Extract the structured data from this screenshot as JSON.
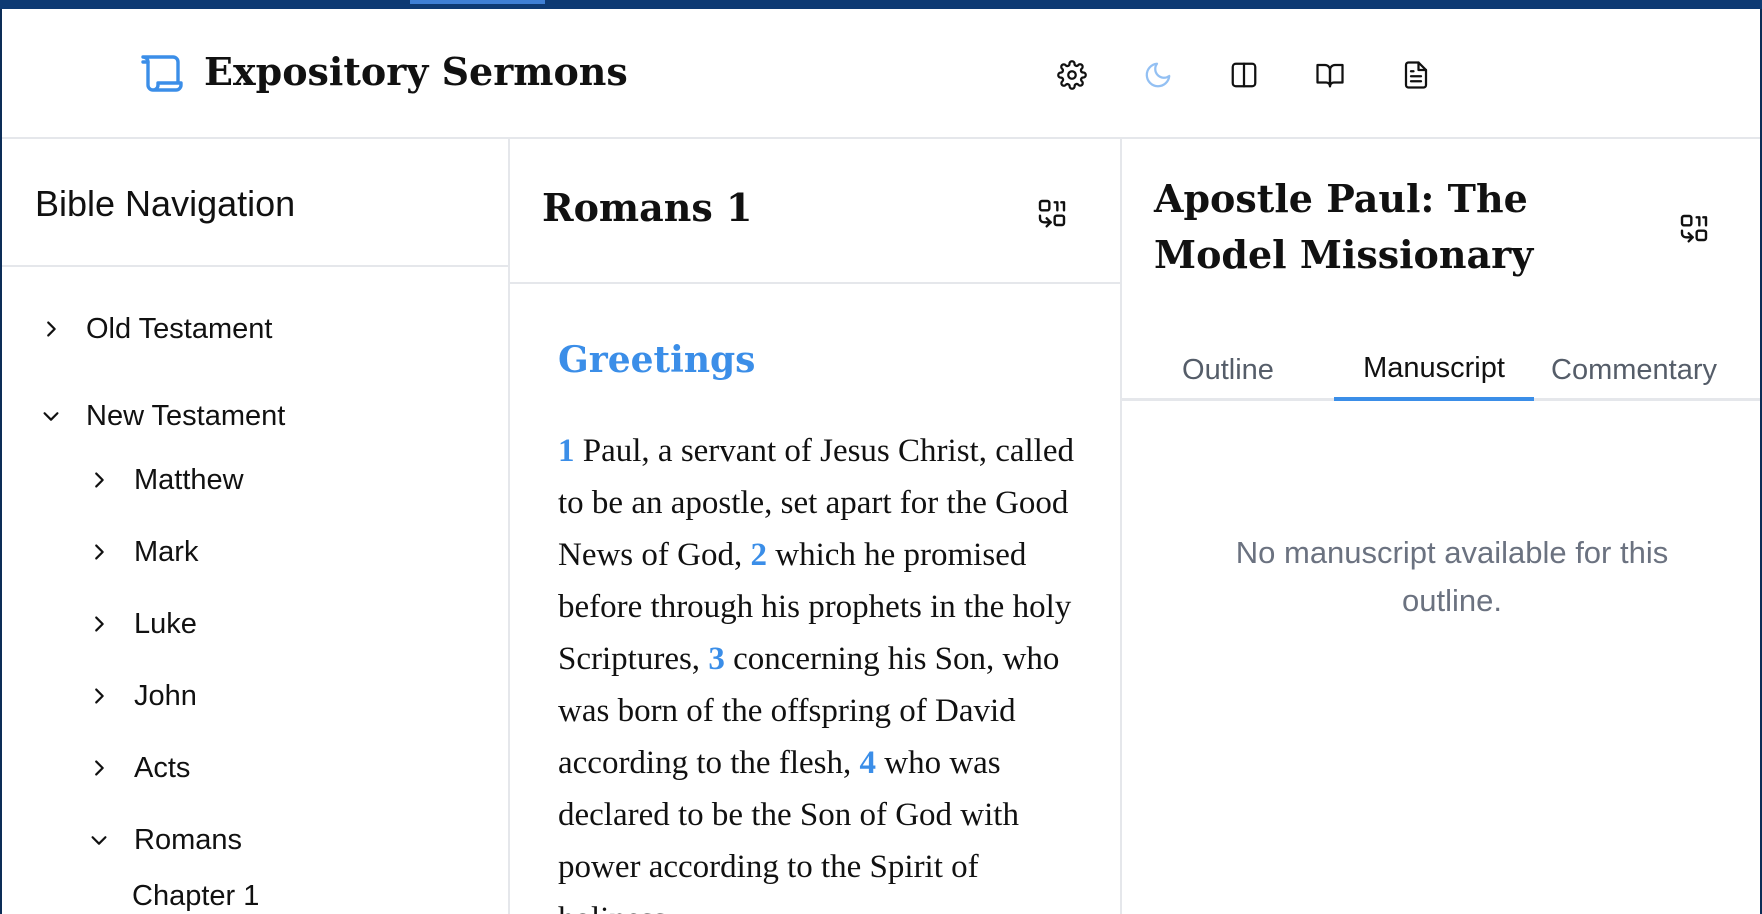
{
  "app": {
    "title": "Expository Sermons",
    "accent_color": "#3b8ee8",
    "brand_icon": "scroll-icon"
  },
  "header": {
    "buttons": [
      {
        "name": "settings",
        "icon": "gear-icon"
      },
      {
        "name": "theme-toggle",
        "icon": "moon-icon"
      },
      {
        "name": "toggle-split-view",
        "icon": "columns-icon"
      },
      {
        "name": "toggle-bible",
        "icon": "book-open-icon"
      },
      {
        "name": "toggle-sermon",
        "icon": "document-icon"
      }
    ]
  },
  "nav": {
    "title": "Bible Navigation",
    "testaments": [
      {
        "label": "Old Testament",
        "expanded": false
      },
      {
        "label": "New Testament",
        "expanded": true
      }
    ],
    "books": [
      {
        "label": "Matthew",
        "expanded": false
      },
      {
        "label": "Mark",
        "expanded": false
      },
      {
        "label": "Luke",
        "expanded": false
      },
      {
        "label": "John",
        "expanded": false
      },
      {
        "label": "Acts",
        "expanded": false
      },
      {
        "label": "Romans",
        "expanded": true
      }
    ],
    "chapters": [
      {
        "label": "Chapter 1"
      }
    ]
  },
  "scripture": {
    "title": "Romans 1",
    "section_heading": "Greetings",
    "verses": [
      {
        "num": "1",
        "text": "Paul, a servant of Jesus Christ, called to be an apostle, set apart for the Good News of God, "
      },
      {
        "num": "2",
        "text": "which he promised before through his prophets in the holy Scriptures, "
      },
      {
        "num": "3",
        "text": "concerning his Son, who was born of the offspring of David according to the flesh, "
      },
      {
        "num": "4",
        "text": "who was declared to be the Son of God with power according to the Spirit of holiness,"
      }
    ]
  },
  "sermon": {
    "title": "Apostle Paul: The Model Missionary",
    "tabs": [
      {
        "label": "Outline",
        "active": false
      },
      {
        "label": "Manuscript",
        "active": true
      },
      {
        "label": "Commentary",
        "active": false
      }
    ],
    "empty_message": "No manuscript available for this outline."
  }
}
